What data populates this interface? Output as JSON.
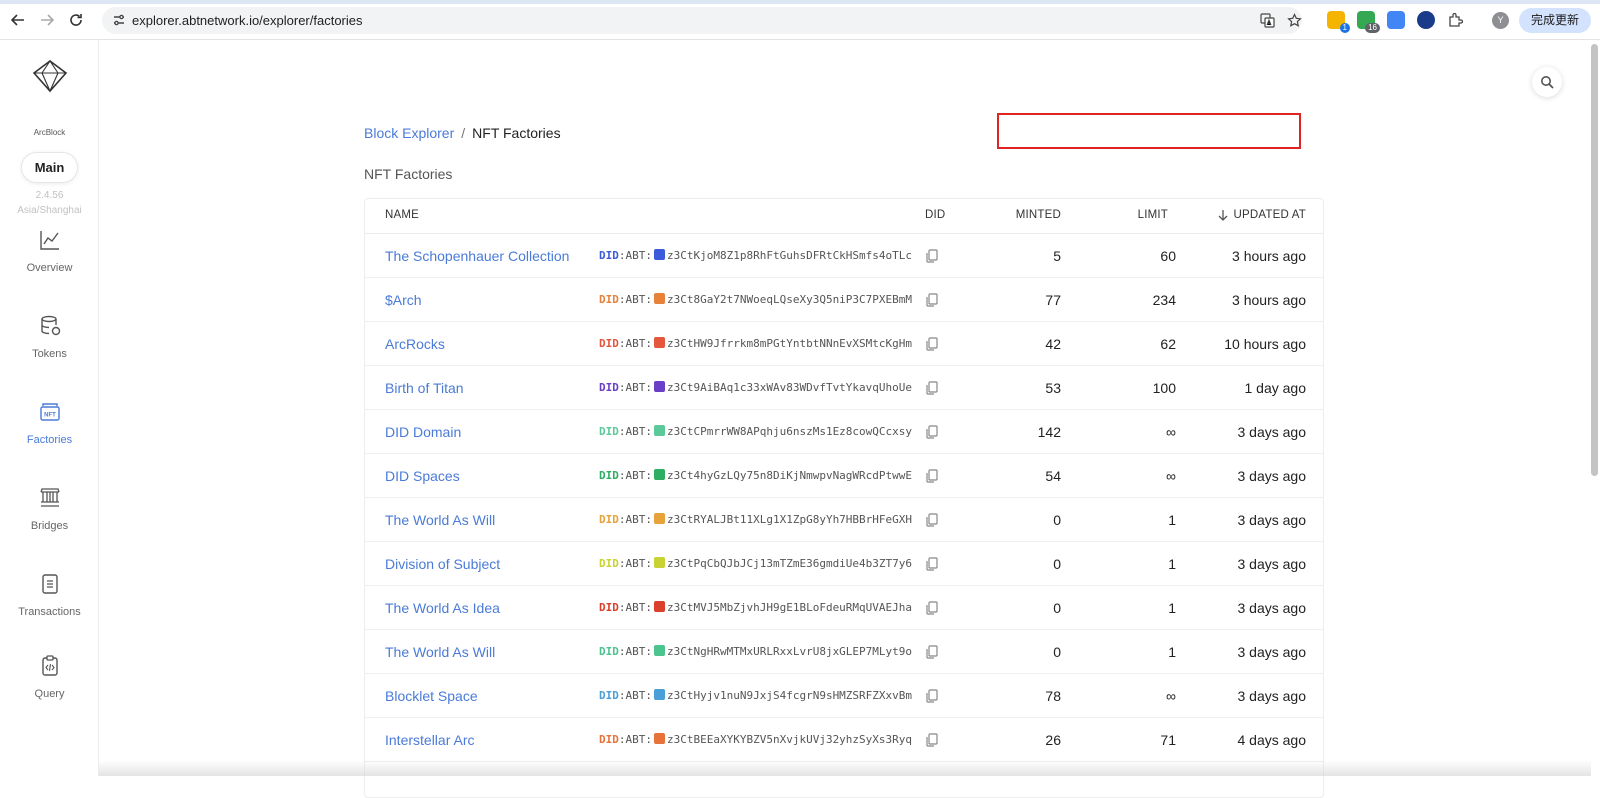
{
  "browser": {
    "url": "explorer.abtnetwork.io/explorer/factories",
    "update_label": "完成更新",
    "profile_initial": "Y",
    "ext_badge_1": "1",
    "ext_badge_2": "16"
  },
  "sidebar": {
    "brand": "ArcBlock",
    "chain_label": "Main",
    "version": "2.4.56",
    "timezone": "Asia/Shanghai",
    "items": [
      {
        "label": "Overview",
        "icon": "chart-line-icon"
      },
      {
        "label": "Tokens",
        "icon": "database-icon"
      },
      {
        "label": "Factories",
        "icon": "nft-icon",
        "active": true
      },
      {
        "label": "Bridges",
        "icon": "bridge-icon"
      },
      {
        "label": "Transactions",
        "icon": "document-icon"
      },
      {
        "label": "Query",
        "icon": "clipboard-code-icon"
      }
    ]
  },
  "breadcrumb": {
    "root": "Block Explorer",
    "separator": "/",
    "current": "NFT Factories"
  },
  "section_title": "NFT Factories",
  "table": {
    "headers": {
      "name": "NAME",
      "did": "DID",
      "minted": "MINTED",
      "limit": "LIMIT",
      "updated": "UPDATED AT"
    },
    "rows": [
      {
        "name": "The Schopenhauer Collection",
        "did_prefix": "DID",
        "did_mid": ":ABT:",
        "did": "z3CtKjoM8Z1p8RhFtGuhsDFRtCkHSmfs4oTLc",
        "minted": "5",
        "limit": "60",
        "updated": "3 hours ago",
        "color": "#3b5bdb"
      },
      {
        "name": "$Arch",
        "did_prefix": "DID",
        "did_mid": ":ABT:",
        "did": "z3Ct8GaY2t7NWoeqLQseXy3Q5niP3C7PXEBmM",
        "minted": "77",
        "limit": "234",
        "updated": "3 hours ago",
        "color": "#e8813a"
      },
      {
        "name": "ArcRocks",
        "did_prefix": "DID",
        "did_mid": ":ABT:",
        "did": "z3CtHW9Jfrrkm8mPGtYntbtNNnEvXSMtcKgHm",
        "minted": "42",
        "limit": "62",
        "updated": "10 hours ago",
        "color": "#e4573d"
      },
      {
        "name": "Birth of Titan",
        "did_prefix": "DID",
        "did_mid": ":ABT:",
        "did": "z3Ct9AiBAq1c33xWAv83WDvfTvtYkavqUhoUe",
        "minted": "53",
        "limit": "100",
        "updated": "1 day ago",
        "color": "#6a3fc8"
      },
      {
        "name": "DID Domain",
        "did_prefix": "DID",
        "did_mid": ":ABT:",
        "did": "z3CtCPmrrWW8APqhju6nszMs1Ez8cowQCcxsy",
        "minted": "142",
        "limit": "∞",
        "updated": "3 days ago",
        "color": "#5cc99a"
      },
      {
        "name": "DID Spaces",
        "did_prefix": "DID",
        "did_mid": ":ABT:",
        "did": "z3Ct4hyGzLQy75n8DiKjNmwpvNagWRcdPtwwE",
        "minted": "54",
        "limit": "∞",
        "updated": "3 days ago",
        "color": "#2eae63"
      },
      {
        "name": "The World As Will",
        "did_prefix": "DID",
        "did_mid": ":ABT:",
        "did": "z3CtRYALJBt11XLg1X1ZpG8yYh7HBBrHFeGXH",
        "minted": "0",
        "limit": "1",
        "updated": "3 days ago",
        "color": "#e8a23a"
      },
      {
        "name": "Division of Subject",
        "did_prefix": "DID",
        "did_mid": ":ABT:",
        "did": "z3CtPqCbQJbJCj13mTZmE36gmdiUe4b3ZT7y6",
        "minted": "0",
        "limit": "1",
        "updated": "3 days ago",
        "color": "#c8d232"
      },
      {
        "name": "The World As Idea",
        "did_prefix": "DID",
        "did_mid": ":ABT:",
        "did": "z3CtMVJ5MbZjvhJH9gE1BLoFdeuRMqUVAEJha",
        "minted": "0",
        "limit": "1",
        "updated": "3 days ago",
        "color": "#d9412c"
      },
      {
        "name": "The World As Will",
        "did_prefix": "DID",
        "did_mid": ":ABT:",
        "did": "z3CtNgHRwMTMxURLRxxLvrU8jxGLEP7MLyt9o",
        "minted": "0",
        "limit": "1",
        "updated": "3 days ago",
        "color": "#4cc48e"
      },
      {
        "name": "Blocklet Space",
        "did_prefix": "DID",
        "did_mid": ":ABT:",
        "did": "z3CtHyjv1nuN9JxjS4fcgrN9sHMZSRFZXxvBm",
        "minted": "78",
        "limit": "∞",
        "updated": "3 days ago",
        "color": "#4a9fd8"
      },
      {
        "name": "Interstellar Arc",
        "did_prefix": "DID",
        "did_mid": ":ABT:",
        "did": "z3CtBEEaXYKYBZV5nXvjkUVj32yhzSyXs3Ryq",
        "minted": "26",
        "limit": "71",
        "updated": "4 days ago",
        "color": "#e8733a"
      }
    ]
  }
}
